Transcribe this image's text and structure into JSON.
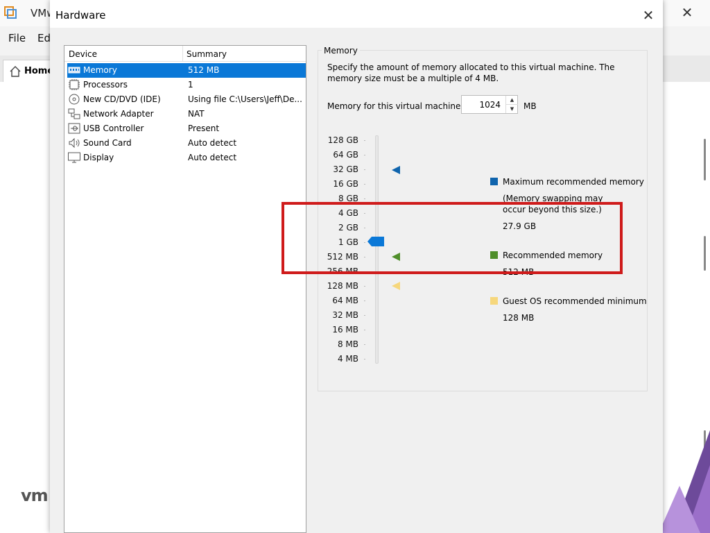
{
  "app": {
    "title": "VMw",
    "menu": [
      "File",
      "Ed"
    ],
    "home_tab": "Home",
    "logo_text": "vm"
  },
  "dialog": {
    "title": "Hardware",
    "device_table": {
      "headers": [
        "Device",
        "Summary"
      ],
      "rows": [
        {
          "name": "Memory",
          "summary": "512 MB",
          "icon": "memory-icon",
          "selected": true
        },
        {
          "name": "Processors",
          "summary": "1",
          "icon": "processor-icon"
        },
        {
          "name": "New CD/DVD (IDE)",
          "summary": "Using file C:\\Users\\Jeff\\De...",
          "icon": "cd-icon"
        },
        {
          "name": "Network Adapter",
          "summary": "NAT",
          "icon": "network-icon"
        },
        {
          "name": "USB Controller",
          "summary": "Present",
          "icon": "usb-icon"
        },
        {
          "name": "Sound Card",
          "summary": "Auto detect",
          "icon": "speaker-icon"
        },
        {
          "name": "Display",
          "summary": "Auto detect",
          "icon": "monitor-icon"
        }
      ]
    },
    "memory": {
      "group_title": "Memory",
      "description": "Specify the amount of memory allocated to this virtual machine. The memory size must be a multiple of 4 MB.",
      "field_label": "Memory for this virtual machine:",
      "value": "1024",
      "unit": "MB",
      "scale_labels": [
        "128 GB",
        "64 GB",
        "32 GB",
        "16 GB",
        "8 GB",
        "4 GB",
        "2 GB",
        "1 GB",
        "512 MB",
        "256 MB",
        "128 MB",
        "64 MB",
        "32 MB",
        "16 MB",
        "8 MB",
        "4 MB"
      ],
      "legend": {
        "max": {
          "title": "Maximum recommended memory",
          "note": "(Memory swapping may occur beyond this size.)",
          "value": "27.9 GB",
          "color": "#0f64ad"
        },
        "recommended": {
          "title": "Recommended memory",
          "value": "512 MB",
          "color": "#4f8e2a"
        },
        "guest_min": {
          "title": "Guest OS recommended minimum",
          "value": "128 MB",
          "color": "#f6d77c"
        }
      },
      "slider_color": "#0a78d7"
    }
  },
  "annotation_color": "#cf1b1b"
}
